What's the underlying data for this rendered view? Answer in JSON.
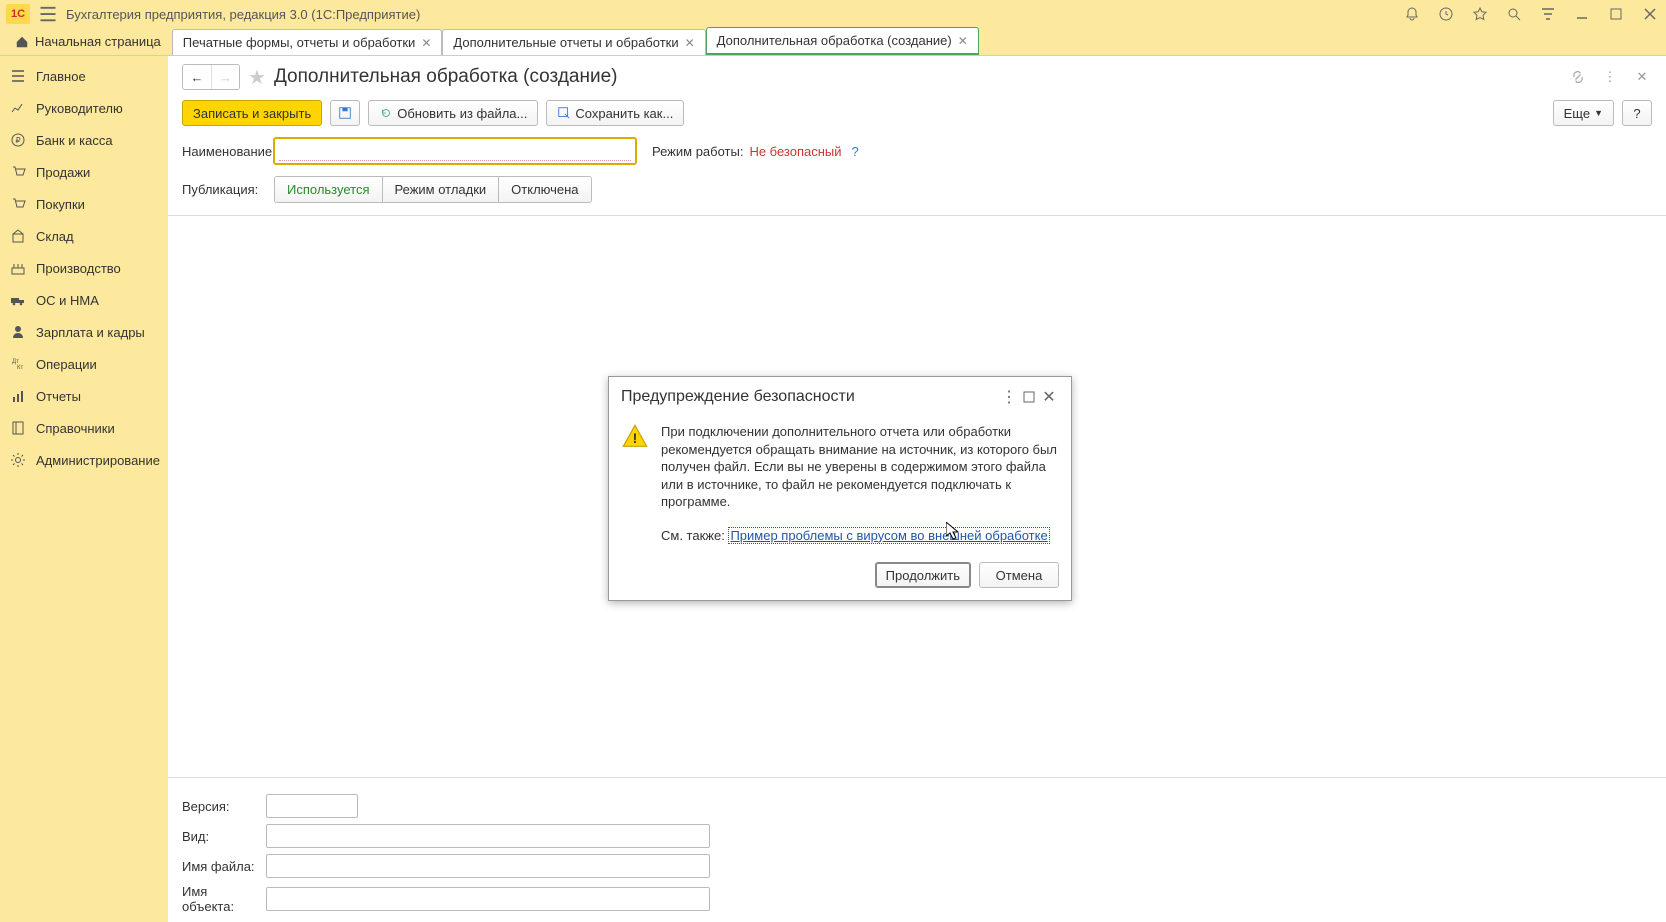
{
  "titlebar": {
    "app_title": "Бухгалтерия предприятия, редакция 3.0  (1С:Предприятие)"
  },
  "tabs": {
    "home": "Начальная страница",
    "items": [
      "Печатные формы, отчеты и обработки",
      "Дополнительные отчеты и обработки",
      "Дополнительная обработка (создание)"
    ]
  },
  "sidebar": {
    "items": [
      "Главное",
      "Руководителю",
      "Банк и касса",
      "Продажи",
      "Покупки",
      "Склад",
      "Производство",
      "ОС и НМА",
      "Зарплата и кадры",
      "Операции",
      "Отчеты",
      "Справочники",
      "Администрирование"
    ]
  },
  "page": {
    "title": "Дополнительная обработка (создание)"
  },
  "toolbar": {
    "save_close": "Записать и закрыть",
    "update_file": "Обновить из файла...",
    "save_as": "Сохранить как...",
    "more": "Еще",
    "help": "?"
  },
  "form": {
    "name_label": "Наименование:",
    "name_value": "",
    "mode_label": "Режим работы:",
    "mode_value": "Не безопасный",
    "pub_label": "Публикация:",
    "pub_options": [
      "Используется",
      "Режим отладки",
      "Отключена"
    ]
  },
  "bottom": {
    "version_label": "Версия:",
    "version_value": "",
    "kind_label": "Вид:",
    "kind_value": "",
    "file_label": "Имя файла:",
    "file_value": "",
    "obj_label": "Имя объекта:",
    "obj_value": ""
  },
  "dialog": {
    "title": "Предупреждение безопасности",
    "text": "При подключении дополнительного отчета или обработки рекомендуется обращать внимание на источник, из которого был получен файл. Если вы не уверены в содержимом этого файла или в источнике, то файл не рекомендуется подключать к программе.",
    "see_also": "См. также:",
    "link": "Пример проблемы с вирусом во внешней обработке",
    "continue": "Продолжить",
    "cancel": "Отмена"
  }
}
